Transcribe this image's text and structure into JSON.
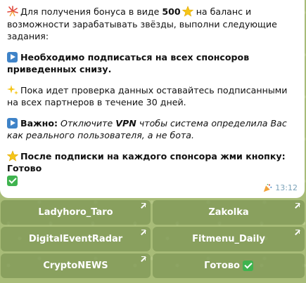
{
  "message": {
    "p1_before": "Для получения бонуса в виде ",
    "p1_bold": "500",
    "p1_after": " на баланс и возможности зарабатывать звёзды, выполни следующие задания:",
    "p2_bold": "Необходимо подписаться на всех спонсоров приведенных снизу.",
    "p3": "Пока идет проверка данных оставайтесь подписанными на всех партнеров в течение 30 дней.",
    "p4_bold": "Важно:",
    "p4_italic_a": "Отключите ",
    "p4_italic_bold": "VPN",
    "p4_italic_b": " чтобы система определила Вас как реального пользователя, а не бота.",
    "p5_bold": "После подписки на каждого спонсора жми кнопку: Готово",
    "time": "13:12"
  },
  "buttons": [
    {
      "label": "Ladyhoro_Taro",
      "link": true
    },
    {
      "label": "Zakolka",
      "link": true
    },
    {
      "label": "DigitalEventRadar",
      "link": true
    },
    {
      "label": "Fitmenu_Daily",
      "link": true
    },
    {
      "label": "CryptoNEWS",
      "link": true
    },
    {
      "label": "Готово",
      "link": false
    }
  ],
  "colors": {
    "play_icon": "#3f83c8",
    "check_icon": "#3fb34f",
    "star_icon": "#f5c518",
    "time_text": "#7aa2b9"
  }
}
